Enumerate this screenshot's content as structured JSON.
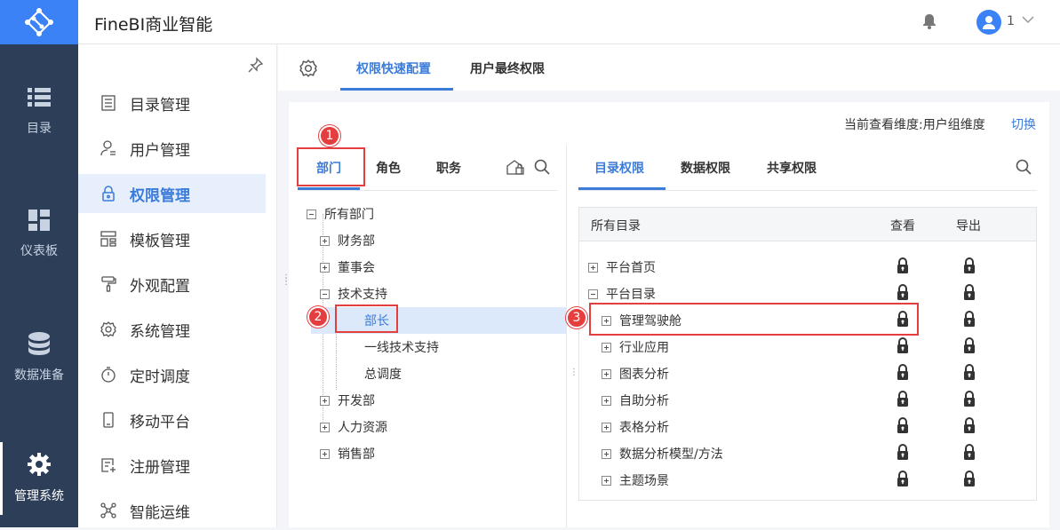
{
  "app": {
    "title": "FineBI商业智能",
    "user": "1"
  },
  "rail": [
    {
      "label": "目录",
      "icon": "list-icon"
    },
    {
      "label": "仪表板",
      "icon": "dashboard-icon"
    },
    {
      "label": "数据准备",
      "icon": "database-icon"
    },
    {
      "label": "管理系统",
      "icon": "gear-icon"
    }
  ],
  "sidebar": [
    {
      "label": "目录管理",
      "icon": "catalog-icon"
    },
    {
      "label": "用户管理",
      "icon": "user-icon"
    },
    {
      "label": "权限管理",
      "icon": "lock-icon"
    },
    {
      "label": "模板管理",
      "icon": "template-icon"
    },
    {
      "label": "外观配置",
      "icon": "paint-roller-icon"
    },
    {
      "label": "系统管理",
      "icon": "settings-icon"
    },
    {
      "label": "定时调度",
      "icon": "timer-icon"
    },
    {
      "label": "移动平台",
      "icon": "mobile-icon"
    },
    {
      "label": "注册管理",
      "icon": "register-icon"
    },
    {
      "label": "智能运维",
      "icon": "ops-icon"
    }
  ],
  "tabs": [
    "权限快速配置",
    "用户最终权限"
  ],
  "dimension": {
    "label": "当前查看维度:用户组维度",
    "switch": "切换"
  },
  "left_tabs": [
    "部门",
    "角色",
    "职务"
  ],
  "tree": [
    {
      "label": "所有部门",
      "type": "minus"
    },
    {
      "label": "财务部",
      "type": "plus"
    },
    {
      "label": "董事会",
      "type": "plus"
    },
    {
      "label": "技术支持",
      "type": "minus"
    },
    {
      "label": "部长",
      "type": "leaf"
    },
    {
      "label": "一线技术支持",
      "type": "leaf"
    },
    {
      "label": "总调度",
      "type": "leaf"
    },
    {
      "label": "开发部",
      "type": "plus"
    },
    {
      "label": "人力资源",
      "type": "plus"
    },
    {
      "label": "销售部",
      "type": "plus"
    }
  ],
  "right_tabs": [
    "目录权限",
    "数据权限",
    "共享权限"
  ],
  "perm_table": {
    "headers": [
      "所有目录",
      "查看",
      "导出"
    ],
    "rows": [
      {
        "label": "平台首页",
        "level": 0
      },
      {
        "label": "平台目录",
        "level": 0,
        "expanded": true
      },
      {
        "label": "管理驾驶舱",
        "level": 1
      },
      {
        "label": "行业应用",
        "level": 1
      },
      {
        "label": "图表分析",
        "level": 1
      },
      {
        "label": "自助分析",
        "level": 1
      },
      {
        "label": "表格分析",
        "level": 1
      },
      {
        "label": "数据分析模型/方法",
        "level": 1
      },
      {
        "label": "主题场景",
        "level": 1
      }
    ]
  },
  "badges": [
    "1",
    "2",
    "3"
  ],
  "colors": {
    "accent": "#3b7bd9",
    "rail": "#2c3e58",
    "highlight": "#e53e3e"
  }
}
